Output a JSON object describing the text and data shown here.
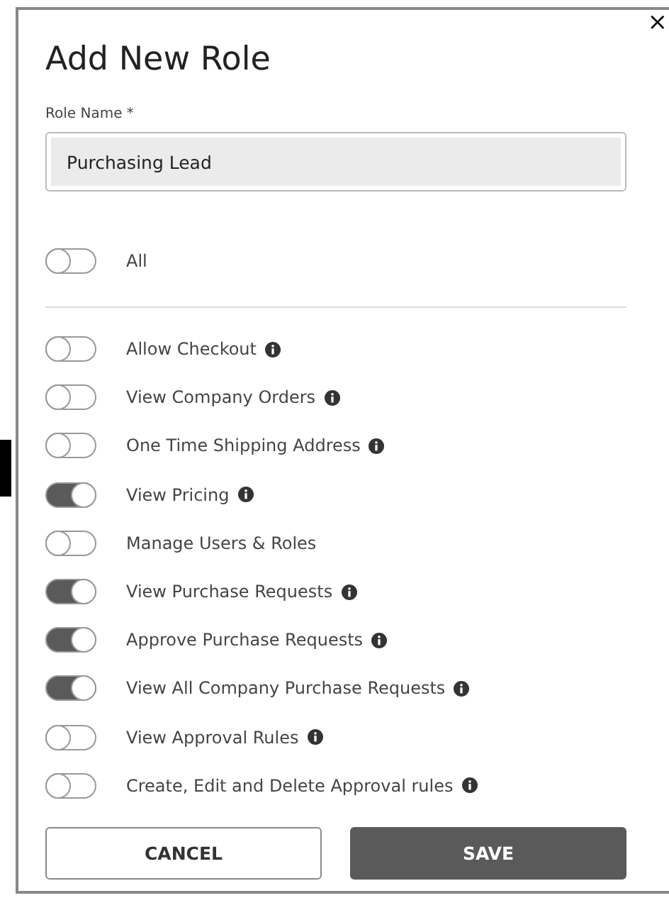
{
  "dialog": {
    "title": "Add New Role",
    "close": "×"
  },
  "role_name": {
    "label": "Role Name *",
    "value": "Purchasing Lead"
  },
  "all_toggle": {
    "label": "All",
    "on": false
  },
  "permissions": [
    {
      "label": "Allow Checkout",
      "on": false,
      "info": true
    },
    {
      "label": "View Company Orders",
      "on": false,
      "info": true
    },
    {
      "label": "One Time Shipping Address",
      "on": false,
      "info": true
    },
    {
      "label": "View Pricing",
      "on": true,
      "info": true
    },
    {
      "label": "Manage Users & Roles",
      "on": false,
      "info": false
    },
    {
      "label": "View Purchase Requests",
      "on": true,
      "info": true
    },
    {
      "label": "Approve Purchase Requests",
      "on": true,
      "info": true
    },
    {
      "label": "View All Company Purchase Requests",
      "on": true,
      "info": true
    },
    {
      "label": "View Approval Rules",
      "on": false,
      "info": true
    },
    {
      "label": "Create, Edit and Delete Approval rules",
      "on": false,
      "info": true
    }
  ],
  "buttons": [
    {
      "label": "CANCEL",
      "kind": "secondary"
    },
    {
      "label": "SAVE",
      "kind": "primary"
    }
  ]
}
